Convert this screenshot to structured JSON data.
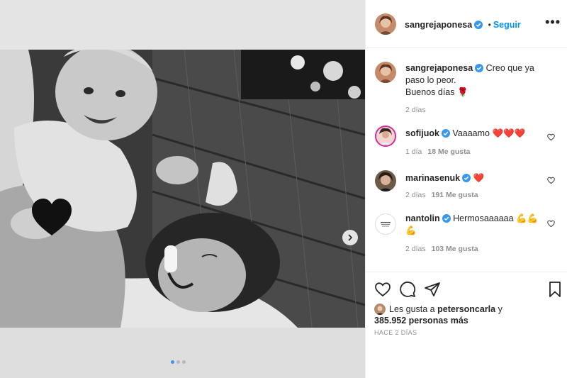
{
  "post": {
    "username": "sangrejaponesa",
    "follow_label": "Seguir",
    "more_label": "•••",
    "caption_line1": "Creo que ya paso lo peor.",
    "caption_line2": "Buenos días 🌹",
    "caption_time": "2 días"
  },
  "comments": [
    {
      "username": "sofijuok",
      "text": "Vaaaamo ❤️❤️❤️",
      "time": "1 día",
      "likes": "18 Me gusta"
    },
    {
      "username": "marinasenuk",
      "text": "❤️",
      "time": "2 días",
      "likes": "191 Me gusta"
    },
    {
      "username": "nantolin",
      "text": "Hermosaaaaaa 💪💪💪",
      "time": "2 días",
      "likes": "103 Me gusta"
    }
  ],
  "likes": {
    "prefix": "Les gusta a",
    "user": "petersoncarla",
    "connector": "y",
    "count": "385.952 personas más"
  },
  "time_ago": "HACE 2 DÍAS",
  "carousel": {
    "slides": 3,
    "active": 0
  },
  "colors": {
    "accent": "#0095f6",
    "verified": "#3897f0",
    "heart": "#ed4956",
    "muted": "#8e8e8e"
  },
  "icons": [
    "verified-icon",
    "more-icon",
    "like-icon",
    "comment-icon",
    "share-icon",
    "save-icon",
    "next-arrow-icon"
  ]
}
